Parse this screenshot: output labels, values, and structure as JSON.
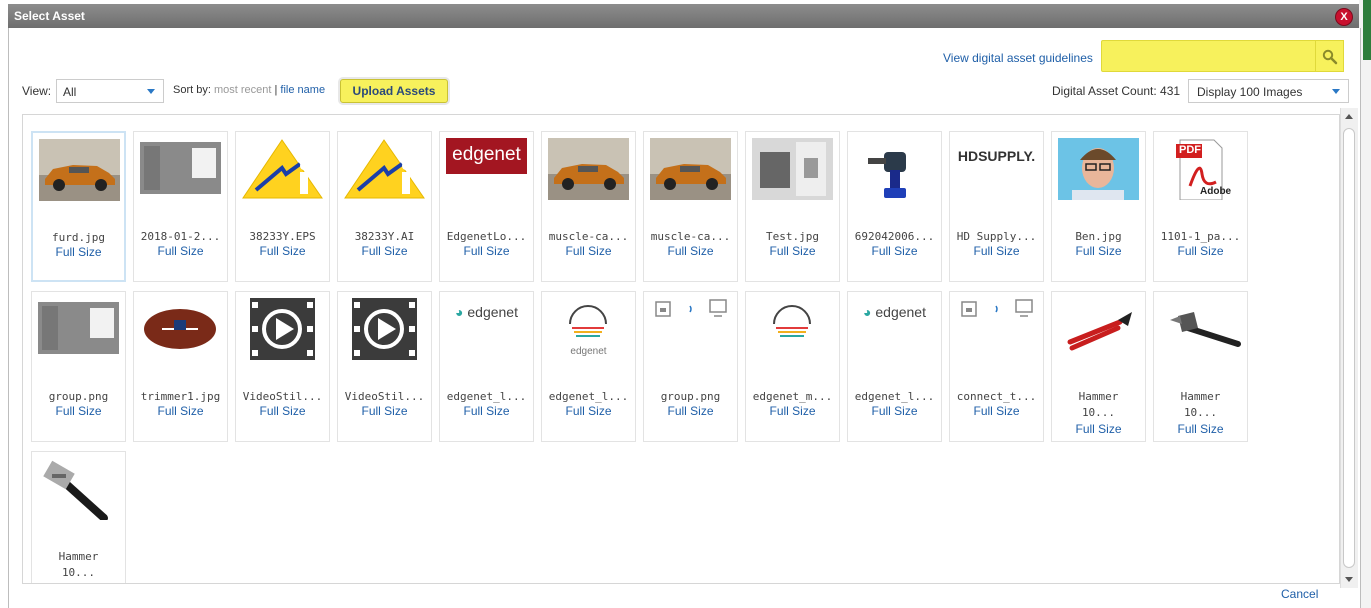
{
  "window": {
    "title": "Select Asset",
    "close_label": "X"
  },
  "header": {
    "guidelines_link": "View digital asset guidelines",
    "search_placeholder": ""
  },
  "toolbar": {
    "view_label": "View:",
    "view_value": "All",
    "sort_label": "Sort by:",
    "sort_most_recent": "most recent",
    "sort_separator": "|",
    "sort_file_name": "file name",
    "upload_label": "Upload Assets",
    "count_label": "Digital Asset Count: 431",
    "display_value": "Display 100 Images"
  },
  "assets": [
    {
      "name": "furd.jpg",
      "link": "Full Size",
      "icon": "car-photo-icon"
    },
    {
      "name": "2018-01-2...",
      "link": "Full Size",
      "icon": "screenshot-icon"
    },
    {
      "name": "38233Y.EPS",
      "link": "Full Size",
      "icon": "warning-sign-icon"
    },
    {
      "name": "38233Y.AI",
      "link": "Full Size",
      "icon": "warning-sign-icon"
    },
    {
      "name": "EdgenetLo...",
      "link": "Full Size",
      "icon": "edgenet-logo-icon",
      "logo_text": "edgenet"
    },
    {
      "name": "muscle-ca...",
      "link": "Full Size",
      "icon": "car-photo-icon"
    },
    {
      "name": "muscle-ca...",
      "link": "Full Size",
      "icon": "car-photo-icon"
    },
    {
      "name": "Test.jpg",
      "link": "Full Size",
      "icon": "photo-icon"
    },
    {
      "name": "692042006...",
      "link": "Full Size",
      "icon": "drill-icon"
    },
    {
      "name": "HD Supply...",
      "link": "Full Size",
      "icon": "hd-supply-logo-icon",
      "logo_text": "HDSUPPLY."
    },
    {
      "name": "Ben.jpg",
      "link": "Full Size",
      "icon": "portrait-icon"
    },
    {
      "name": "1101-1_pa...",
      "link": "Full Size",
      "icon": "pdf-icon",
      "pdf_label": "PDF",
      "brand_label": "Adobe"
    },
    {
      "name": "group.png",
      "link": "Full Size",
      "icon": "screenshot-icon"
    },
    {
      "name": "trimmer1.jpg",
      "link": "Full Size",
      "icon": "football-icon"
    },
    {
      "name": "VideoStil...",
      "link": "Full Size",
      "icon": "video-icon"
    },
    {
      "name": "VideoStil...",
      "link": "Full Size",
      "icon": "video-icon"
    },
    {
      "name": "edgenet_l...",
      "link": "Full Size",
      "icon": "edgenet-logo-icon",
      "logo_text": "edgenet"
    },
    {
      "name": "edgenet_l...",
      "link": "Full Size",
      "icon": "edgenet-mark-icon",
      "logo_text": "edgenet"
    },
    {
      "name": "group.png",
      "link": "Full Size",
      "icon": "connect-icons-icon"
    },
    {
      "name": "edgenet_m...",
      "link": "Full Size",
      "icon": "edgenet-mark-icon"
    },
    {
      "name": "edgenet_l...",
      "link": "Full Size",
      "icon": "edgenet-logo-icon",
      "logo_text": "edgenet"
    },
    {
      "name": "connect_t...",
      "link": "Full Size",
      "icon": "connect-icons-icon"
    },
    {
      "name": "Hammer",
      "name2": "10...",
      "link": "Full Size",
      "icon": "bolt-cutter-icon"
    },
    {
      "name": "Hammer",
      "name2": "10...",
      "link": "Full Size",
      "icon": "hammer-icon"
    },
    {
      "name": "Hammer",
      "name2": "10...",
      "link": "",
      "icon": "pipe-wrench-icon"
    }
  ],
  "footer": {
    "cancel_label": "Cancel"
  }
}
